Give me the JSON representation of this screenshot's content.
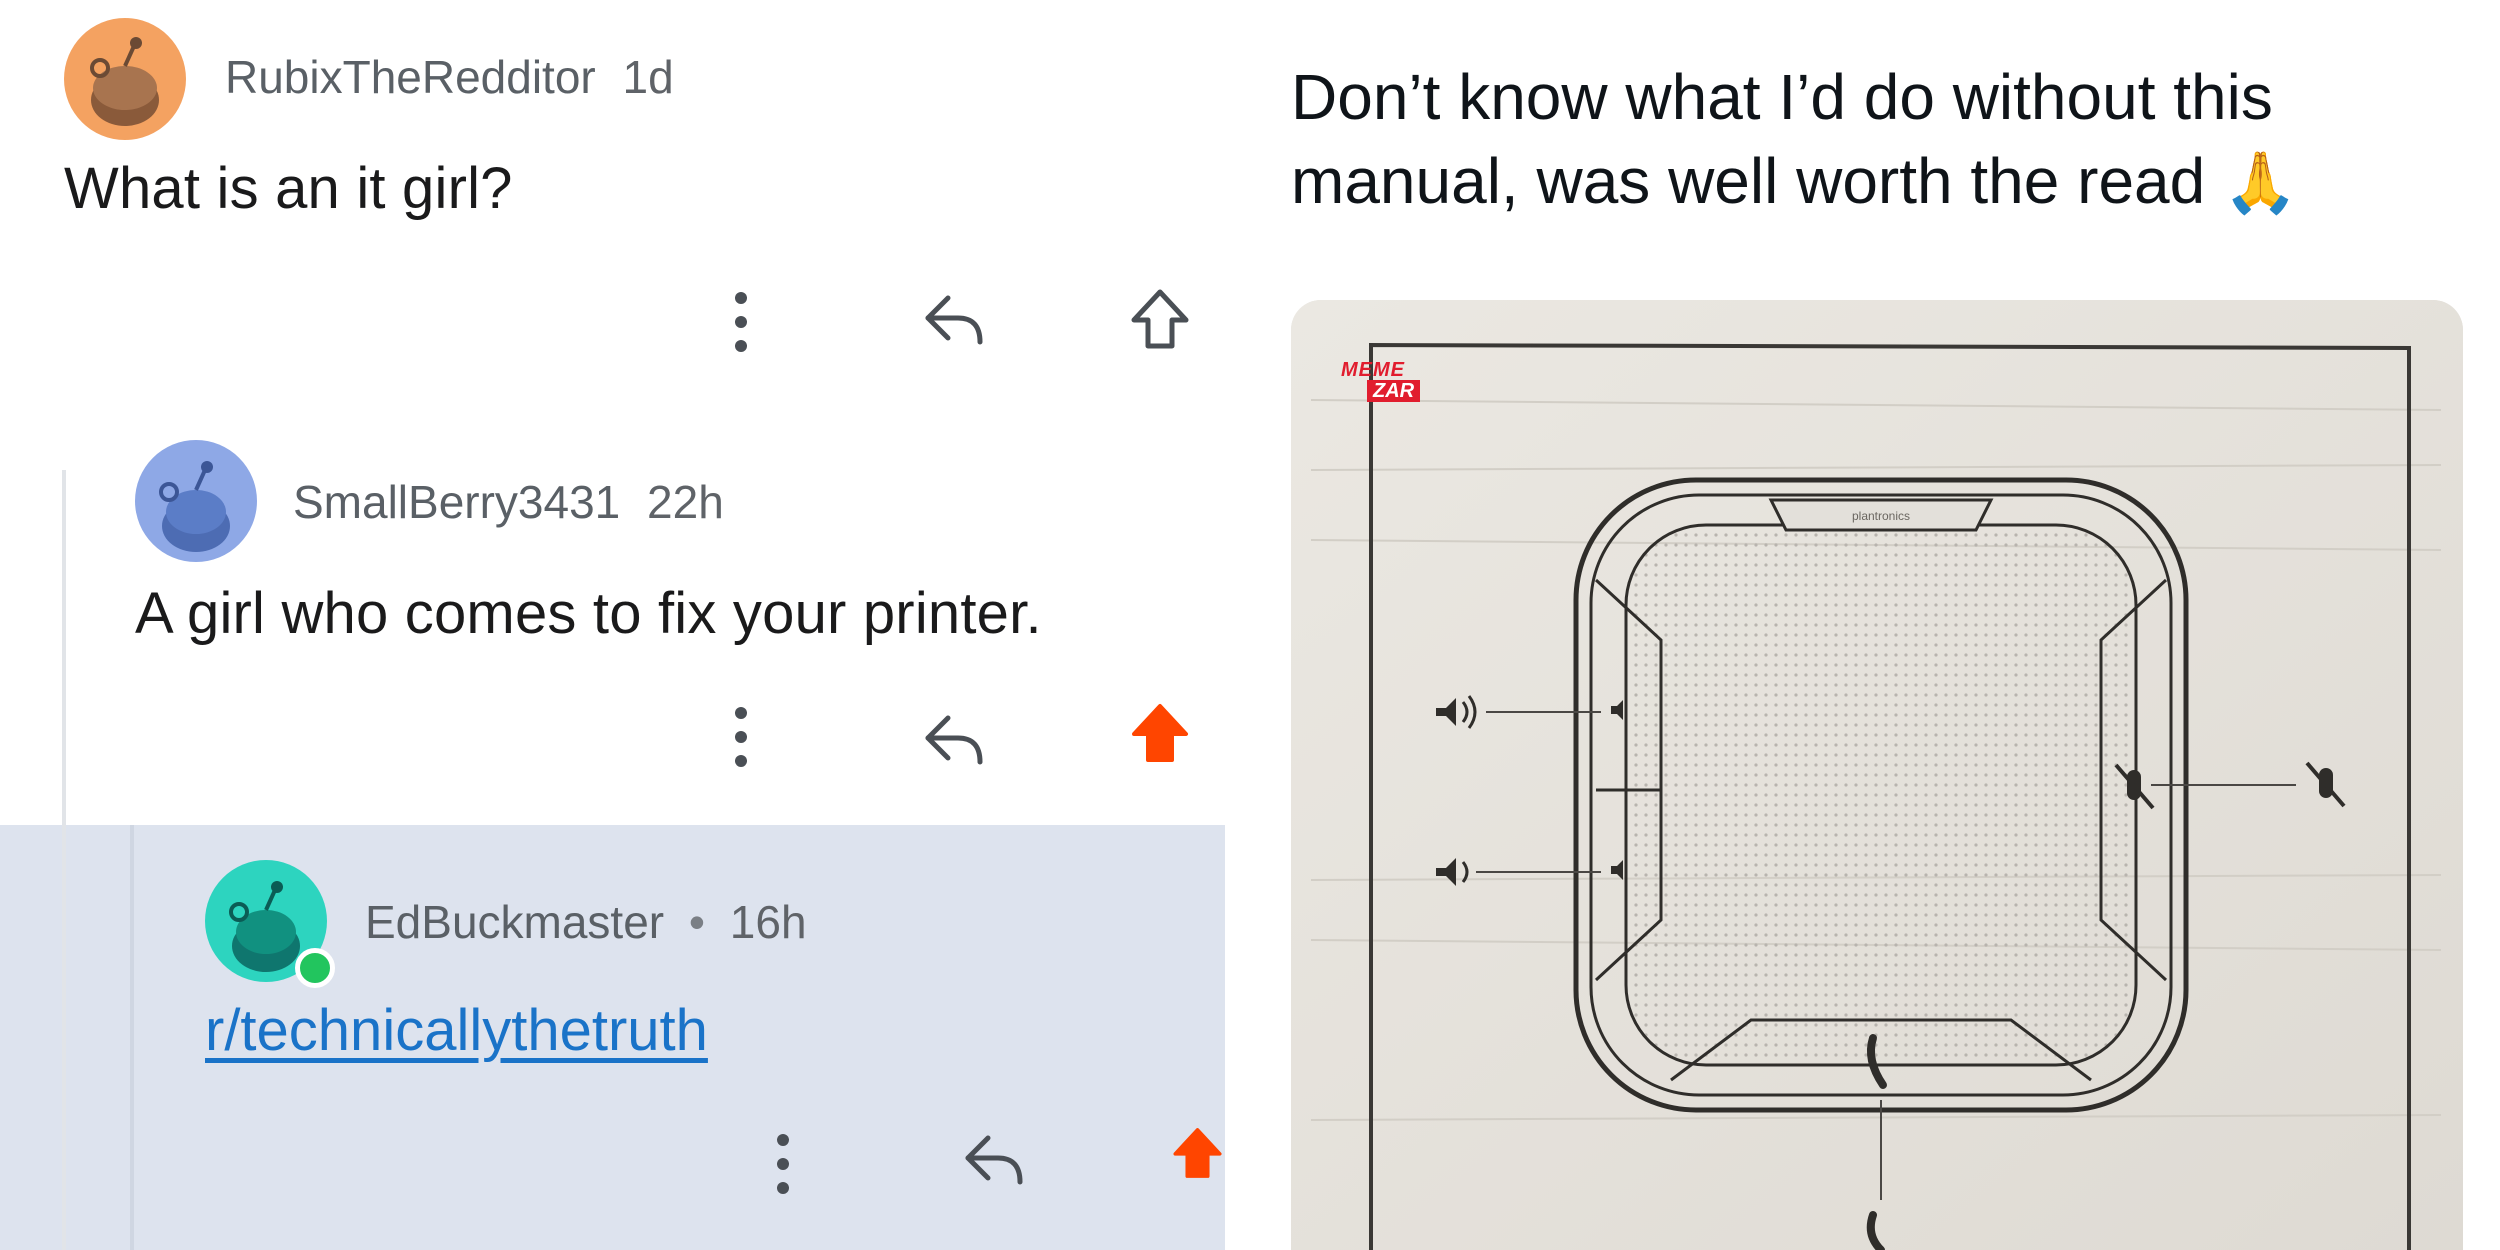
{
  "left": {
    "comments": [
      {
        "username": "RubixTheRedditor",
        "time": "1d",
        "separator": "",
        "text": "What is an it girl?",
        "avatar_color": "#f4a261"
      },
      {
        "username": "SmallBerry3431",
        "time": "22h",
        "separator": "",
        "text": "A girl who comes to fix your printer.",
        "avatar_color": "#8ea8e6"
      },
      {
        "username": "EdBuckmaster",
        "time": "16h",
        "separator": "•",
        "link": "r/technicallythetruth",
        "avatar_color": "#2dd4bf"
      }
    ],
    "colors": {
      "upvote_active": "#ff4500",
      "highlight": "#dde3ee",
      "link": "#1a73c8"
    }
  },
  "right": {
    "post_text_line1": "Don’t know what I’d do without this",
    "post_text_line2": "manual, was well worth the read",
    "emoji": "🙏",
    "watermark_line1": "MEME",
    "watermark_line2": "ZAR",
    "device_brand": "plantronics"
  }
}
